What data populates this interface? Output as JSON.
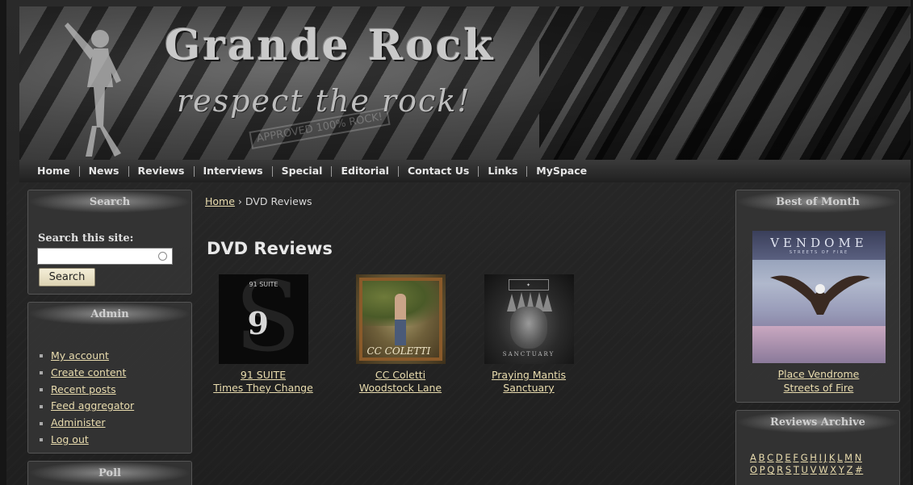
{
  "site": {
    "title": "Grande Rock",
    "slogan": "respect the rock!",
    "stamp": "APPROVED 100% ROCK!"
  },
  "nav": {
    "items": [
      "Home",
      "News",
      "Reviews",
      "Interviews",
      "Special",
      "Editorial",
      "Contact Us",
      "Links",
      "MySpace"
    ]
  },
  "search_block": {
    "title": "Search",
    "label": "Search this site:",
    "input_value": "",
    "button_label": "Search"
  },
  "admin_block": {
    "title": "Admin",
    "items": [
      "My account",
      "Create content",
      "Recent posts",
      "Feed aggregator",
      "Administer",
      "Log out"
    ]
  },
  "poll_block": {
    "title": "Poll"
  },
  "breadcrumb": {
    "home": "Home",
    "separator": "›",
    "current": "DVD Reviews"
  },
  "main": {
    "page_title": "DVD Reviews",
    "reviews": [
      {
        "artist": "91 SUITE",
        "album": "Times They Change",
        "cover_text": "91 SUITE"
      },
      {
        "artist": "CC Coletti",
        "album": "Woodstock Lane",
        "cover_text": "CC COLETTI"
      },
      {
        "artist": "Praying Mantis",
        "album": "Sanctuary",
        "cover_text": "SANCTUARY"
      }
    ]
  },
  "best_of_month": {
    "title": "Best of Month",
    "cover_title": "VENDOME",
    "cover_subtitle": "STREETS OF FIRE",
    "line1": "Place Vendrome",
    "line2": "Streets of Fire"
  },
  "reviews_archive": {
    "title": "Reviews Archive",
    "row1": [
      "A",
      "B",
      "C",
      "D",
      "E",
      "F",
      "G",
      "H",
      "I",
      "J",
      "K",
      "L",
      "M",
      "N"
    ],
    "row2": [
      "O",
      "P",
      "Q",
      "R",
      "S",
      "T",
      "U",
      "V",
      "W",
      "X",
      "Y",
      "Z",
      "#"
    ]
  },
  "colors": {
    "link": "#e9dcae",
    "background": "#262626",
    "block_bg": "#343434"
  }
}
